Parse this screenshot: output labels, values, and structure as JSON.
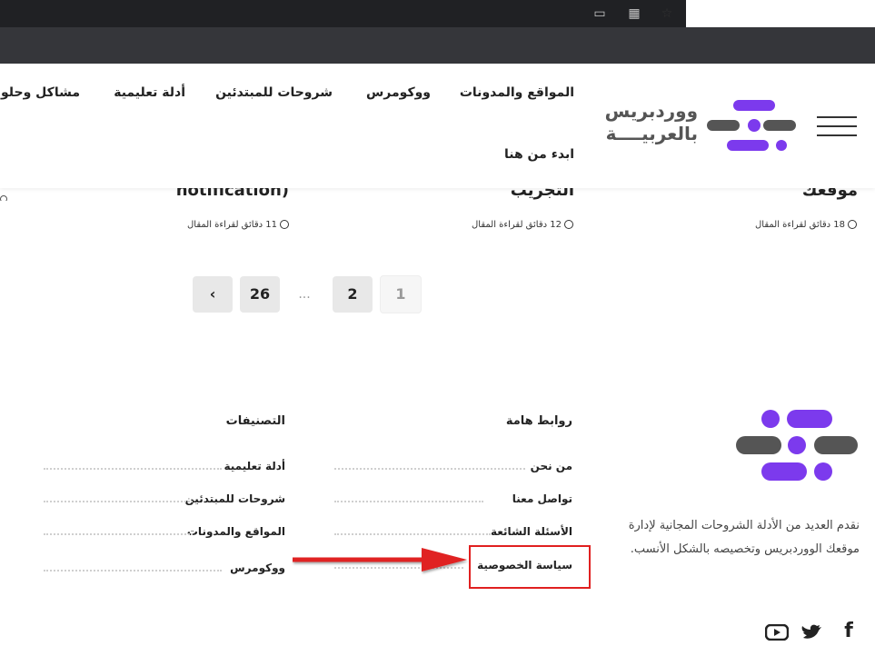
{
  "header": {
    "logo_line1": "ووردبريس",
    "logo_line2": "بالعربيــــة",
    "nav": [
      "المواقع والمدونات",
      "ووكومرس",
      "شروحات للمبتدئين",
      "أدلة تعليمية",
      "مشاكل وحلول",
      "ابدء من هنا"
    ]
  },
  "cards": [
    {
      "title": "موقعك",
      "meta": "18 دقائق لقراءة المقال"
    },
    {
      "title": "التجريب",
      "meta": "12 دقائق لقراءة المقال"
    },
    {
      "title": "(notification",
      "meta": "11 دقائق لقراءة المقال"
    }
  ],
  "pagination": {
    "current": "1",
    "next": "2",
    "dots": "...",
    "last": "26",
    "arrow": "‹"
  },
  "footer": {
    "description": "نقدم العديد من الأدلة الشروحات المجانية لإدارة موقعك الووردبريس وتخصيصه بالشكل الأنسب.",
    "important_links": {
      "heading": "روابط هامة",
      "items": [
        "من نحن",
        "تواصل معنا",
        "الأسئلة الشائعة",
        "سياسة الخصوصية"
      ]
    },
    "categories": {
      "heading": "التصنيفات",
      "items": [
        "أدلة تعليمية",
        "شروحات للمبتدئين",
        "المواقع والمدونات",
        "ووكومرس"
      ]
    },
    "social": [
      "facebook-icon",
      "twitter-icon",
      "youtube-icon"
    ]
  },
  "colors": {
    "brand_purple": "#7c3aed",
    "brand_gray": "#555555",
    "annotation_red": "#e02020"
  }
}
